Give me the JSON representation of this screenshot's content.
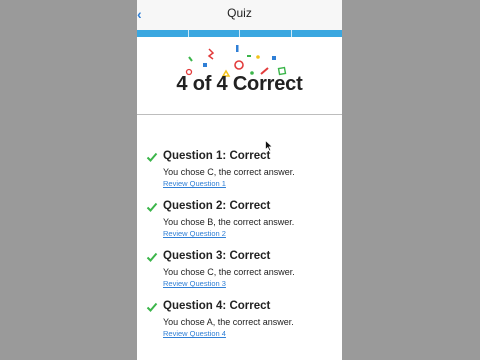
{
  "nav": {
    "title": "Quiz",
    "back_glyph": "‹"
  },
  "progress": {
    "segments": 4,
    "completed": 4,
    "color": "#3aa7e0"
  },
  "summary": {
    "score_text": "4 of 4 Correct"
  },
  "results": [
    {
      "title": "Question 1: Correct",
      "message": "You chose C, the correct answer.",
      "link": "Review Question 1"
    },
    {
      "title": "Question 2: Correct",
      "message": "You chose B, the correct answer.",
      "link": "Review Question 2"
    },
    {
      "title": "Question 3: Correct",
      "message": "You chose C, the correct answer.",
      "link": "Review Question 3"
    },
    {
      "title": "Question 4: Correct",
      "message": "You chose A, the correct answer.",
      "link": "Review Question 4"
    }
  ],
  "colors": {
    "accent": "#2f7fd6",
    "check": "#3bb54a",
    "background": "#9a9a9a"
  },
  "icons": {
    "back": "chevron-left-icon",
    "status": "checkmark-icon",
    "decoration": "confetti-icon",
    "pointer": "mouse-cursor-icon"
  }
}
